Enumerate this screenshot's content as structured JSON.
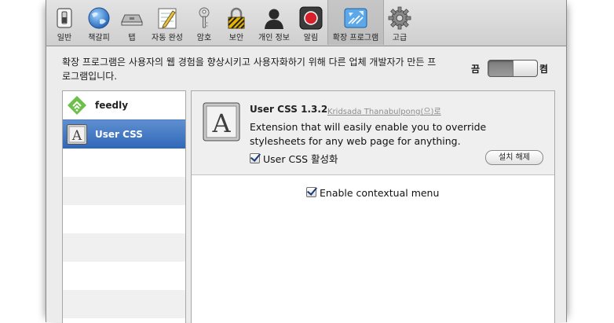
{
  "toolbar": {
    "items": [
      {
        "label": "일반",
        "icon": "general-switch-icon"
      },
      {
        "label": "책갈피",
        "icon": "globe-icon"
      },
      {
        "label": "탭",
        "icon": "tabs-icon"
      },
      {
        "label": "자동 완성",
        "icon": "autofill-pencil-icon"
      },
      {
        "label": "암호",
        "icon": "key-icon"
      },
      {
        "label": "보안",
        "icon": "lock-icon"
      },
      {
        "label": "개인 정보",
        "icon": "person-silhouette-icon"
      },
      {
        "label": "알림",
        "icon": "notification-icon"
      },
      {
        "label": "확장 프로그램",
        "icon": "extensions-icon"
      },
      {
        "label": "고급",
        "icon": "gear-icon"
      }
    ],
    "selected": "확장 프로그램"
  },
  "description": "확장 프로그램은 사용자의 웹 경험을 향상시키고 사용자화하기 위해 다른 업체 개발자가 만든 프로그램입니다.",
  "master_switch": {
    "off_label": "끔",
    "on_label": "켬",
    "state": "on"
  },
  "extensions": [
    {
      "name": "feedly",
      "icon": "feedly-icon",
      "selected": false
    },
    {
      "name": "User CSS",
      "icon": "user-css-letter-a-icon",
      "selected": true
    }
  ],
  "detail": {
    "name": "User CSS",
    "version": "1.3.2",
    "author": "Kridsada Thanabulpong(으)로",
    "description": "Extension that will easily enable you to override stylesheets for any web page for anything.",
    "enable_label": "User CSS 활성화",
    "enabled": true,
    "uninstall_label": "설치 해제",
    "option_label": "Enable contextual menu",
    "option_checked": true
  }
}
